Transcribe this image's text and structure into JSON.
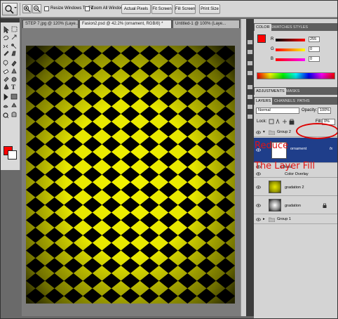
{
  "options_bar": {
    "resize_windows_label": "Resize Windows To Fit",
    "zoom_all_label": "Zoom All Windows",
    "actual_pixels": "Actual Pixels",
    "fit_screen": "Fit Screen",
    "fill_screen": "Fill Screen",
    "print_size": "Print Size"
  },
  "doc_tabs": [
    "STEP 7.jpg @ 120% (Laye...",
    "Fasion2.psd @ 42.2% (ornament, RGB/8) *",
    "Untitled-1 @ 100% (Laye..."
  ],
  "color_panel": {
    "tabs": [
      "COLOR",
      "SWATCHES",
      "STYLES"
    ],
    "channels": [
      {
        "label": "R",
        "value": "255"
      },
      {
        "label": "G",
        "value": "0"
      },
      {
        "label": "B",
        "value": "0"
      }
    ],
    "fg_color": "#ff0000"
  },
  "adjustments_panel": {
    "tabs": [
      "ADJUSTMENTS",
      "MASKS"
    ]
  },
  "layers_panel": {
    "tabs": [
      "LAYERS",
      "CHANNELS",
      "PATHS"
    ],
    "blend_mode": "Normal",
    "opacity_label": "Opacity:",
    "opacity_value": "100%",
    "lock_label": "Lock:",
    "fill_label": "Fill:",
    "fill_value": "0%",
    "layers": [
      {
        "name": "Group 2",
        "kind": "group",
        "expanded": true
      },
      {
        "name": "ornament",
        "kind": "layer",
        "selected": true,
        "fx": "fx"
      },
      {
        "name": "Effects",
        "kind": "effects"
      },
      {
        "name": "Color Overlay",
        "kind": "effect-item"
      },
      {
        "name": "gradation 2",
        "kind": "layer"
      },
      {
        "name": "gradation",
        "kind": "layer"
      },
      {
        "name": "Group 1",
        "kind": "group",
        "expanded": false
      }
    ]
  },
  "annotation": {
    "line1": "Reduce",
    "line2": "The Layer Fill",
    "color": "#e01414"
  },
  "artwork": {
    "colors": {
      "yellow": "#f2f200",
      "dark": "#000000"
    },
    "columns": 11,
    "rows": 17
  }
}
